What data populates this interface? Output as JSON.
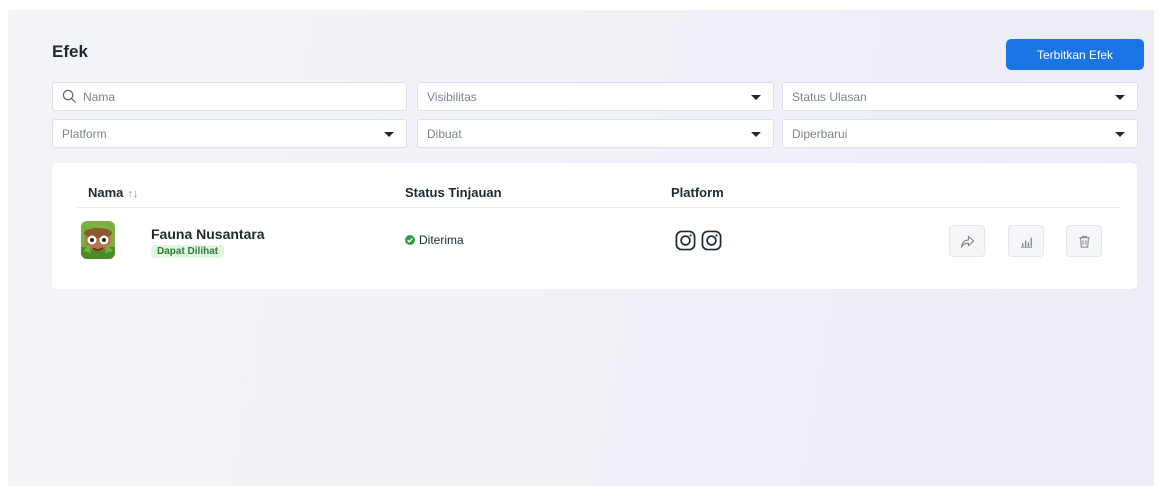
{
  "page": {
    "title": "Efek",
    "publish_button_label": "Terbitkan Efek"
  },
  "filters": {
    "search_placeholder": "Nama",
    "visibility": "Visibilitas",
    "review_status": "Status Ulasan",
    "platform": "Platform",
    "created": "Dibuat",
    "updated": "Diperbarui"
  },
  "table": {
    "columns": {
      "name": "Nama",
      "review_status": "Status Tinjauan",
      "platform": "Platform"
    },
    "rows": [
      {
        "name": "Fauna Nusantara",
        "visibility_badge": "Dapat Dilihat",
        "status": "Diterima",
        "platform_icons": [
          "instagram-icon",
          "instagram-icon"
        ]
      }
    ]
  },
  "colors": {
    "accent": "#1b74e4",
    "status_ok": "#2e9e44",
    "badge_bg": "#e3f3e4"
  }
}
